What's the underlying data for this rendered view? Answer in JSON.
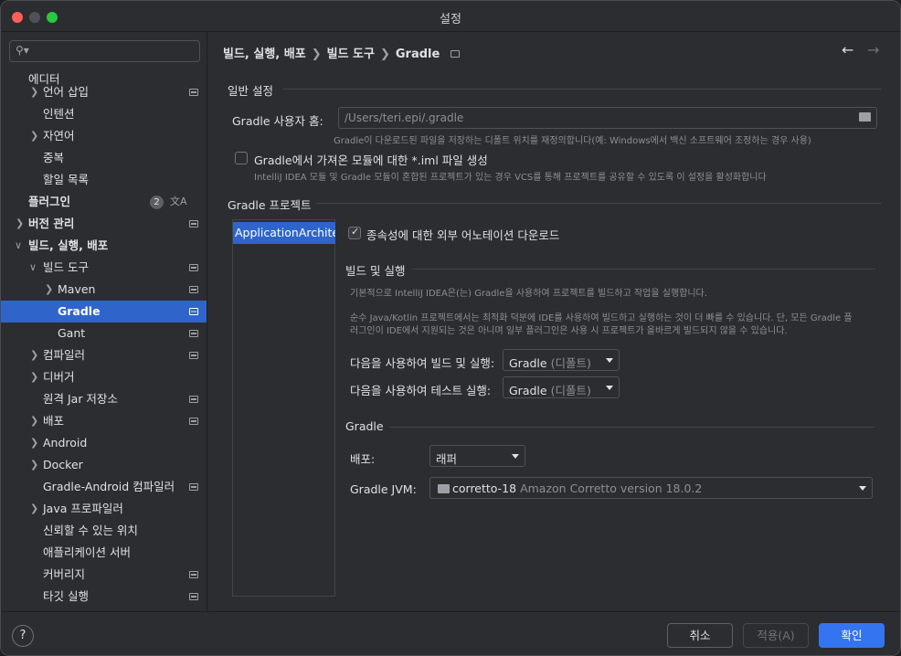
{
  "window": {
    "title": "설정"
  },
  "sidebar": {
    "search_placeholder": "",
    "items": [
      {
        "label": "에디터"
      },
      {
        "label": "언어 삽입"
      },
      {
        "label": "인텐션"
      },
      {
        "label": "자연어"
      },
      {
        "label": "중복"
      },
      {
        "label": "할일 목록"
      },
      {
        "label": "플러그인",
        "badge": "2"
      },
      {
        "label": "버전 관리"
      },
      {
        "label": "빌드, 실행, 배포"
      },
      {
        "label": "빌드 도구"
      },
      {
        "label": "Maven"
      },
      {
        "label": "Gradle"
      },
      {
        "label": "Gant"
      },
      {
        "label": "컴파일러"
      },
      {
        "label": "디버거"
      },
      {
        "label": "원격 Jar 저장소"
      },
      {
        "label": "배포"
      },
      {
        "label": "Android"
      },
      {
        "label": "Docker"
      },
      {
        "label": "Gradle-Android 컴파일러"
      },
      {
        "label": "Java 프로파일러"
      },
      {
        "label": "신뢰할 수 있는 위치"
      },
      {
        "label": "애플리케이션 서버"
      },
      {
        "label": "커버리지"
      },
      {
        "label": "타깃 실행"
      }
    ]
  },
  "breadcrumb": [
    "빌드, 실행, 배포",
    "빌드 도구",
    "Gradle"
  ],
  "general": {
    "title": "일반 설정",
    "user_home_label": "Gradle 사용자 홈:",
    "user_home_value": "/Users/teri.epi/.gradle",
    "user_home_hint": "Gradle이 다운로드된 파일을 저장하는 디폴트 위치를 재정의합니다(예: Windows에서 백신 소프트웨어 조정하는 경우 사용)",
    "iml_label": "Gradle에서 가져온 모듈에 대한 *.iml 파일 생성",
    "iml_hint": "IntelliJ IDEA 모듈 및 Gradle 모듈이 혼합된 프로젝트가 있는 경우 VCS를 통해 프로젝트를 공유할 수 있도록 이 설정을 활성화합니다"
  },
  "projects": {
    "title": "Gradle 프로젝트",
    "items": [
      "ApplicationArchite"
    ],
    "annotations_label": "종속성에 대한 외부 어노테이션 다운로드",
    "build_run": {
      "title": "빌드 및 실행",
      "desc1": "기본적으로 IntelliJ IDEA은(는) Gradle을 사용하여 프로젝트를 빌드하고 작업을 실행합니다.",
      "desc2a": "순수 Java/Kotlin 프로젝트에서는 최적화 덕분에 IDE를 사용하여 빌드하고 실행하는 것이 더 빠를 수 있습니다. 단, 모든 Gradle 플",
      "desc2b": "러그인이 IDE에서 지원되는 것은 아니며 일부 플러그인은 사용 시 프로젝트가 올바르게 빌드되지 않을 수 있습니다.",
      "build_label": "다음을 사용하여 빌드 및 실행:",
      "build_value": "Gradle",
      "build_value_suffix": "(디폴트)",
      "test_label": "다음을 사용하여 테스트 실행:",
      "test_value": "Gradle",
      "test_value_suffix": "(디폴트)"
    },
    "gradle": {
      "title": "Gradle",
      "distribution_label": "배포:",
      "distribution_value": "래퍼",
      "jvm_label": "Gradle JVM:",
      "jvm_value": "corretto-18",
      "jvm_detail": "Amazon Corretto version 18.0.2"
    }
  },
  "footer": {
    "help": "?",
    "cancel": "취소",
    "apply": "적용(A)",
    "ok": "확인"
  },
  "colors": {
    "accent": "#3574f0",
    "selection": "#2f65ca",
    "background": "#2b2d30"
  }
}
